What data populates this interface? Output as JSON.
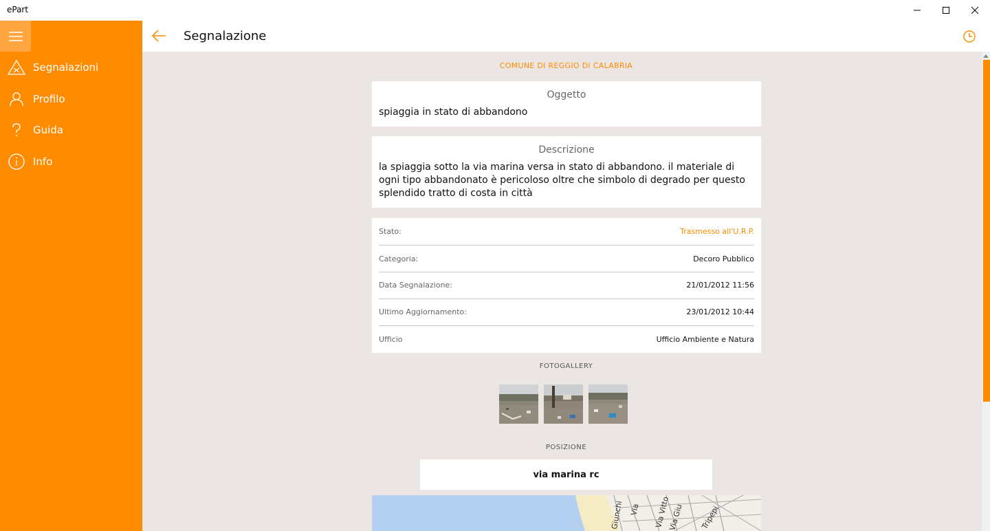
{
  "window": {
    "title": "ePart"
  },
  "sidebar": {
    "items": [
      {
        "label": "Segnalazioni",
        "icon": "warning-icon"
      },
      {
        "label": "Profilo",
        "icon": "person-icon"
      },
      {
        "label": "Guida",
        "icon": "question-icon"
      },
      {
        "label": "Info",
        "icon": "info-icon"
      }
    ]
  },
  "header": {
    "title": "Segnalazione"
  },
  "report": {
    "municipality": "COMUNE DI REGGIO DI CALABRIA",
    "subject_title": "Oggetto",
    "subject": "spiaggia in stato di abbandono",
    "description_title": "Descrizione",
    "description": "la spiaggia sotto la via marina versa in stato di abbandono. il materiale di ogni tipo abbandonato è pericoloso oltre che simbolo di degrado per questo splendido tratto di costa in città",
    "details": [
      {
        "label": "Stato:",
        "value": "Trasmesso all'U.R.P."
      },
      {
        "label": "Categoria:",
        "value": "Decoro Pubblico"
      },
      {
        "label": "Data Segnalazione:",
        "value": "21/01/2012 11:56"
      },
      {
        "label": "Ultimo Aggiornamento:",
        "value": "23/01/2012 10:44"
      },
      {
        "label": "Ufficio",
        "value": "Ufficio Ambiente e Natura"
      }
    ],
    "gallery_label": "FOTOGALLERY",
    "position_label": "POSIZIONE",
    "address": "via marina rc"
  },
  "map": {
    "streets": [
      "Giunchi",
      "Via",
      "Via Vitto",
      "Via Giu",
      "Tripepi"
    ]
  },
  "colors": {
    "accent": "#ff8c00",
    "background": "#ebe5e3",
    "sea": "#b3d0f0"
  }
}
